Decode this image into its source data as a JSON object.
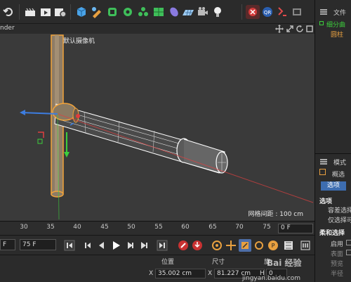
{
  "toolbar": {
    "icons": [
      "undo-icon",
      "render-region-icon",
      "render-view-icon",
      "render-settings-icon",
      "cube-icon",
      "pen-icon",
      "subdivision-icon",
      "cloner-icon",
      "deformer-icon",
      "scene-icon",
      "camera-icon",
      "light-icon"
    ]
  },
  "viewport_header": {
    "menu_tail": "nder"
  },
  "viewport": {
    "camera_label": "默认摄像机",
    "grid_spacing": "网格间距 : 100 cm",
    "background": "#3a3a3a",
    "selection_color": "#f2a33a",
    "wire_color": "#ffffff"
  },
  "timeline": {
    "ticks": [
      "30",
      "35",
      "40",
      "45",
      "50",
      "55",
      "60",
      "65",
      "70",
      "75"
    ],
    "end_frame_field": "0 F"
  },
  "transport": {
    "current_frame_field": "F",
    "max_frame_field": "75 F"
  },
  "coords": {
    "position_header": "位置",
    "size_header": "尺寸",
    "rotation_header": "旋",
    "x_label": "X",
    "position_x": "35.002 cm",
    "x_label_2": "X",
    "size_x": "81.227 cm",
    "h_label": "H",
    "rotation_h": "0"
  },
  "right_panel": {
    "file_menu": "文件",
    "object_item": "细分曲",
    "object_child": "圆柱",
    "mode_header": "模式",
    "mode_sub": "概选",
    "tab_options": "选项",
    "section_options": "选项",
    "row_tolerant": "容差选择",
    "row_only_visible": "仅选择可",
    "section_soft": "柔和选择",
    "row_enable": "启用",
    "row_surface": "表面",
    "row_preview": "预览",
    "row_width": "半径"
  },
  "watermark": {
    "text": "jingyan.baidu.com",
    "brand": "Bai 经验"
  },
  "accent_colors": {
    "panel": "#2b2b2b",
    "viewport": "#3a3a3a",
    "active_tab": "#3d6db0",
    "axis_x": "#e04040",
    "axis_y": "#3ccf3c",
    "axis_z": "#3d7de0"
  }
}
